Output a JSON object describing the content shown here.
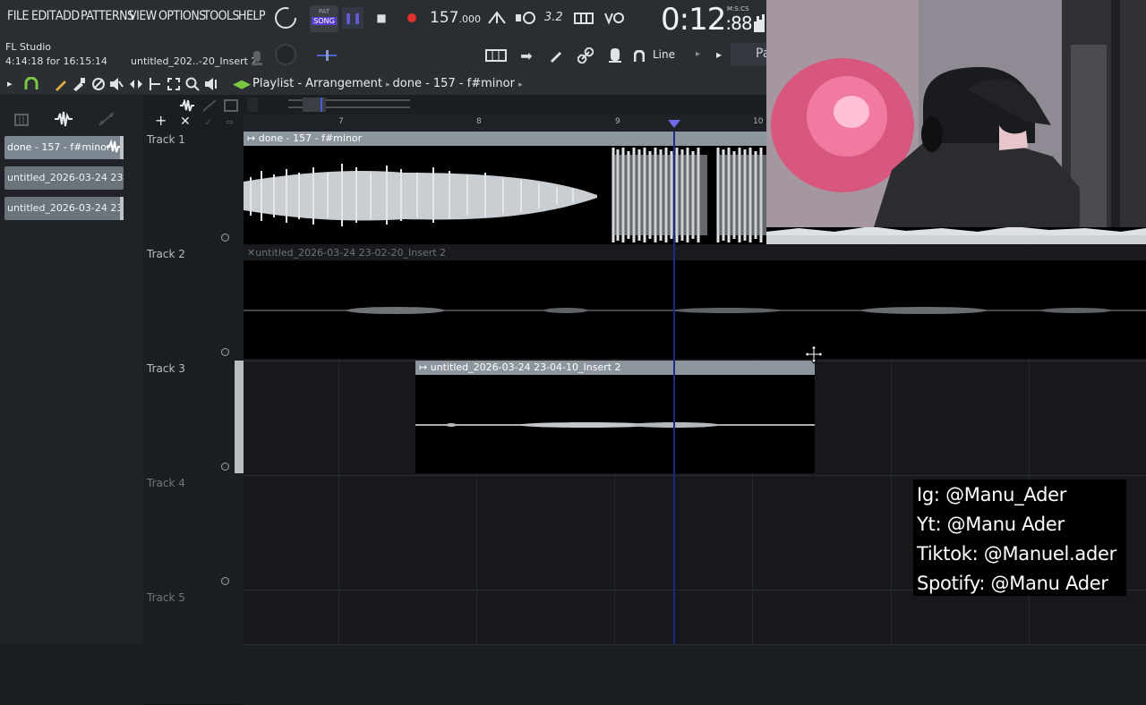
{
  "menu": [
    "FILE",
    "EDIT",
    "ADD",
    "PATTERNS",
    "VIEW",
    "OPTIONS",
    "TOOLS",
    "HELP"
  ],
  "transport": {
    "pat_label": "PAT",
    "song_label": "SONG",
    "tempo_int": "157",
    "tempo_dec": ".000",
    "step_label": "3.2",
    "time_main": "0:12",
    "time_sub": ":88",
    "time_units": "M:S:CS"
  },
  "hint": {
    "app": "FL Studio",
    "time_for": "4:14:18 for 16:15:14",
    "selected": "untitled_202..-20_Insert 2"
  },
  "toolbar2": {
    "snap_label": "Line",
    "pa_label": "Pa"
  },
  "playlist": {
    "title": "Playlist - Arrangement",
    "pattern": "done - 157 - f#minor",
    "ruler": [
      "7",
      "8",
      "9",
      "10"
    ]
  },
  "clip_list": [
    "done - 157 - f#minor",
    "untitled_2026-03-24 23-...",
    "untitled_2026-03-24 23-..."
  ],
  "tracks": [
    "Track 1",
    "Track 2",
    "Track 3",
    "Track 4",
    "Track 5"
  ],
  "clips": {
    "c1": "done - 157 - f#minor",
    "c2": "untitled_2026-03-24 23-02-20_Insert 2",
    "c3": "untitled_2026-03-24 23-04-10_Insert 2"
  },
  "social": {
    "ig": "Ig: @Manu_Ader",
    "yt": "Yt: @Manu Ader",
    "tiktok": "Tiktok: @Manuel.ader",
    "spotify": "Spotify: @Manu Ader"
  },
  "colors": {
    "accent_green": "#7ac943",
    "record_red": "#e0312f",
    "playhead": "#1c2a8a",
    "clip_header": "#8c949c"
  }
}
